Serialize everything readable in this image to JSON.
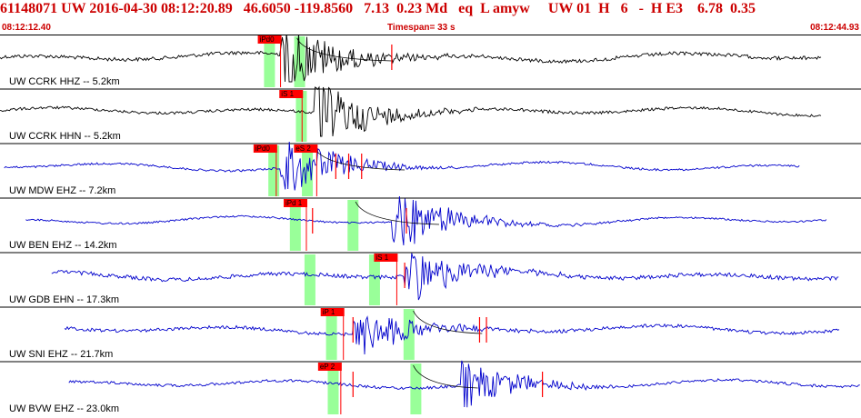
{
  "header": {
    "event_id": "61148071",
    "network": "UW",
    "datetime": "2016-04-30 08:12:20.89",
    "lat": "46.6050",
    "lon": "-119.8560",
    "depth": "7.13",
    "magnitude": "0.23",
    "mag_type": "Md",
    "etype": "eq",
    "loc": "L",
    "author": "amyw",
    "source": "UW",
    "version": "01",
    "gtype": "H",
    "nsta": "6",
    "dash": "-",
    "quality": "H E3",
    "rms": "6.78",
    "err": "0.35"
  },
  "timebar": {
    "start": "08:12:12.40",
    "span": "Timespan=  33 s",
    "end": "08:12:44.93"
  },
  "colors": {
    "header_red": "#cc0000",
    "trace_black": "#000000",
    "trace_blue": "#0000cc",
    "pick_red": "#ff0000",
    "window_green": "#99ff99"
  },
  "traces": [
    {
      "label": "UW CCRK HHZ -- 5.2km",
      "color": "black",
      "amp": 0.8,
      "burst": 2.6,
      "tstart": 0.0,
      "tend": 0.955,
      "onset": 0.325,
      "windows": [
        0.313,
        0.348
      ],
      "picks": [
        {
          "text": "iPd0",
          "t": 0.31
        }
      ],
      "marks": [
        0.455
      ],
      "curve": [
        0.345,
        0.455
      ]
    },
    {
      "label": "UW CCRK HHN -- 5.2km",
      "color": "black",
      "amp": 0.6,
      "burst": 2.4,
      "tstart": 0.0,
      "tend": 0.955,
      "onset": 0.365,
      "windows": [
        0.35
      ],
      "picks": [
        {
          "text": "iS 1",
          "t": 0.335
        }
      ],
      "marks": [],
      "curve": []
    },
    {
      "label": "UW MDW EHZ -- 7.2km",
      "color": "blue",
      "amp": 0.45,
      "burst": 2.2,
      "tstart": 0.005,
      "tend": 0.93,
      "onset": 0.325,
      "windows": [
        0.318,
        0.357
      ],
      "picks": [
        {
          "text": "iPd0",
          "t": 0.305
        },
        {
          "text": "eS 2",
          "t": 0.352
        }
      ],
      "marks": [
        0.39,
        0.405,
        0.42
      ],
      "curve": [
        0.365,
        0.47
      ]
    },
    {
      "label": "UW BEN EHZ -- 14.2km",
      "color": "blue",
      "amp": 0.4,
      "burst": 2.2,
      "tstart": 0.03,
      "tend": 0.96,
      "onset": 0.455,
      "windows": [
        0.343,
        0.41
      ],
      "picks": [
        {
          "text": "iPd 1",
          "t": 0.34
        }
      ],
      "marks": [
        0.363,
        0.472
      ],
      "curve": [
        0.413,
        0.51
      ]
    },
    {
      "label": "UW GDB EHN -- 17.3km",
      "color": "blue",
      "amp": 0.85,
      "burst": 2.0,
      "tstart": 0.06,
      "tend": 0.975,
      "onset": 0.47,
      "windows": [
        0.36,
        0.435
      ],
      "picks": [
        {
          "text": "iS 1",
          "t": 0.445
        }
      ],
      "marks": [
        0.47
      ],
      "curve": []
    },
    {
      "label": "UW SNI EHZ -- 21.7km",
      "color": "blue",
      "amp": 0.7,
      "burst": 1.8,
      "tstart": 0.075,
      "tend": 0.975,
      "onset": 0.41,
      "windows": [
        0.385,
        0.475
      ],
      "picks": [
        {
          "text": "iP 1",
          "t": 0.383
        }
      ],
      "marks": [
        0.41,
        0.557,
        0.565
      ],
      "curve": [
        0.48,
        0.56
      ]
    },
    {
      "label": "UW BVW EHZ -- 23.0km",
      "color": "blue",
      "amp": 0.6,
      "burst": 1.7,
      "tstart": 0.08,
      "tend": 1.0,
      "onset": 0.535,
      "windows": [
        0.387,
        0.483
      ],
      "picks": [
        {
          "text": "eP 2",
          "t": 0.38
        }
      ],
      "marks": [
        0.41,
        0.63
      ],
      "curve": [
        0.48,
        0.555
      ]
    }
  ]
}
